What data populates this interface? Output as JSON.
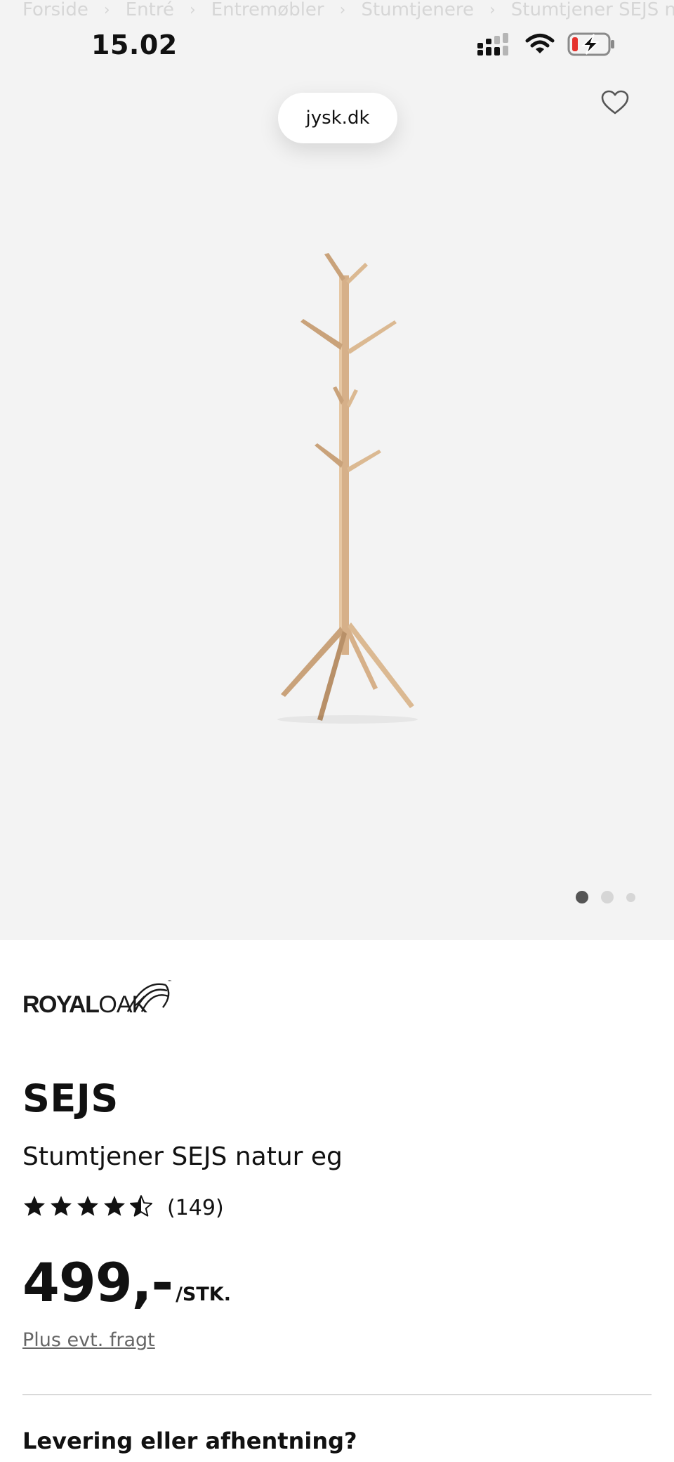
{
  "breadcrumb": [
    "Forside",
    "Entré",
    "Entremøbler",
    "Stumtjenere",
    "Stumtjener SEJS n"
  ],
  "status_bar": {
    "time": "15.02",
    "battery_state": "charging-low"
  },
  "browser": {
    "url": "jysk.dk"
  },
  "gallery": {
    "image_count": 3,
    "active_index": 0
  },
  "brand": {
    "name_bold": "ROYAL",
    "name_light": "OAK",
    "trademark": "™"
  },
  "product": {
    "name": "SEJS",
    "subtitle": "Stumtjener SEJS natur eg",
    "rating": 4.5,
    "review_count": "(149)",
    "price": "499,-",
    "unit": "/STK.",
    "shipping_note": "Plus evt. fragt"
  },
  "delivery": {
    "heading": "Levering eller afhentning?"
  },
  "icons": {
    "favorite": "heart-outline-icon",
    "signal": "cellular-signal-icon",
    "wifi": "wifi-icon",
    "battery": "battery-charging-icon"
  },
  "colors": {
    "wood": "#d6b089",
    "text": "#111111",
    "muted": "#666666",
    "battery_low": "#e5322d"
  }
}
